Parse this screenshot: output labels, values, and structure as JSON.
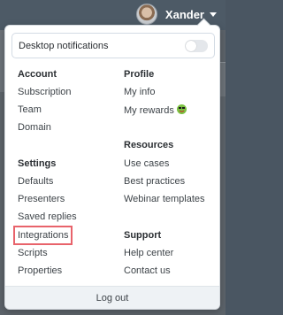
{
  "header": {
    "username": "Xander"
  },
  "dropdown": {
    "notifications": {
      "label": "Desktop notifications",
      "enabled": false
    },
    "account": {
      "title": "Account",
      "items": [
        "Subscription",
        "Team",
        "Domain"
      ]
    },
    "profile": {
      "title": "Profile",
      "items": [
        "My info",
        "My rewards"
      ]
    },
    "resources": {
      "title": "Resources",
      "items": [
        "Use cases",
        "Best practices",
        "Webinar templates"
      ]
    },
    "settings": {
      "title": "Settings",
      "items": [
        "Defaults",
        "Presenters",
        "Saved replies",
        "Integrations",
        "Scripts",
        "Properties"
      ]
    },
    "support": {
      "title": "Support",
      "items": [
        "Help center",
        "Contact us"
      ]
    },
    "logout_label": "Log out"
  },
  "colors": {
    "highlight": "#e8636b",
    "topbar": "#4d5a66"
  },
  "icons": {
    "rewards": "green-smiley-emoji-icon"
  }
}
